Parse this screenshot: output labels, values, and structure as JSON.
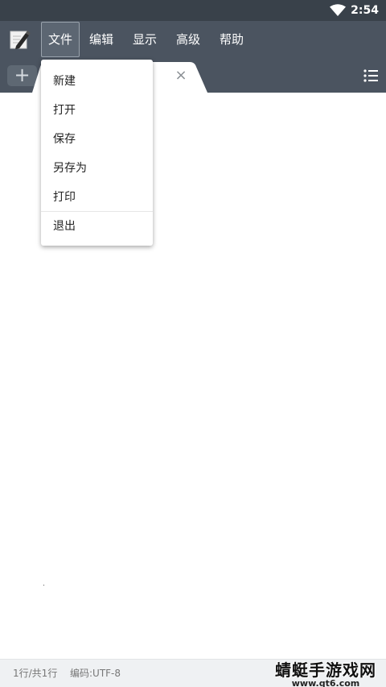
{
  "status_bar": {
    "time": "2:54",
    "icons": [
      "wifi-icon"
    ]
  },
  "menubar": {
    "logo_icon": "notepad-pencil-icon",
    "items": [
      {
        "label": "文件",
        "active": true
      },
      {
        "label": "编辑"
      },
      {
        "label": "显示"
      },
      {
        "label": "高级"
      },
      {
        "label": "帮助"
      }
    ]
  },
  "tabbar": {
    "add_label": "+",
    "close_label": "×",
    "list_icon": "list-icon"
  },
  "file_menu": {
    "items": [
      "新建",
      "打开",
      "保存",
      "另存为",
      "打印",
      "退出"
    ]
  },
  "footer": {
    "position": "1行/共1行",
    "encoding": "编码:UTF-8"
  },
  "watermark": {
    "name": "蜻蜓手游戏网",
    "url": "www.qt6.com"
  },
  "colors": {
    "toolbar": "#4b5460",
    "status_bar": "#39414a",
    "footer": "#eff1f3"
  }
}
